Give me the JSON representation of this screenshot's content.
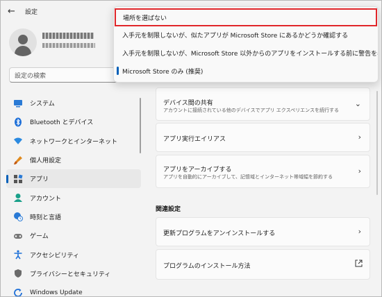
{
  "window": {
    "title": "設定"
  },
  "search": {
    "placeholder": "設定の検索"
  },
  "sidebar": {
    "items": [
      {
        "label": "システム",
        "icon": "monitor-icon"
      },
      {
        "label": "Bluetooth とデバイス",
        "icon": "bluetooth-icon"
      },
      {
        "label": "ネットワークとインターネット",
        "icon": "wifi-icon"
      },
      {
        "label": "個人用設定",
        "icon": "brush-icon"
      },
      {
        "label": "アプリ",
        "icon": "apps-icon"
      },
      {
        "label": "アカウント",
        "icon": "person-icon"
      },
      {
        "label": "時刻と言語",
        "icon": "globe-clock-icon"
      },
      {
        "label": "ゲーム",
        "icon": "gamepad-icon"
      },
      {
        "label": "アクセシビリティ",
        "icon": "accessibility-icon"
      },
      {
        "label": "プライバシーとセキュリティ",
        "icon": "shield-icon"
      },
      {
        "label": "Windows Update",
        "icon": "update-icon"
      }
    ]
  },
  "dropdown": {
    "options": [
      "場所を選ばない",
      "入手元を制限しないが、似たアプリが Microsoft Store にあるかどうか確認する",
      "入手元を制限しないが、Microsoft Store 以外からのアプリをインストールする前に警告を表示する",
      "Microsoft Store のみ (推奨)"
    ]
  },
  "main": {
    "share": {
      "title": "デバイス間の共有",
      "desc": "アカウントに接続されている他のデバイスでアプリ エクスペリエンスを続行する"
    },
    "alias": {
      "title": "アプリ実行エイリアス"
    },
    "archive": {
      "title": "アプリをアーカイブする",
      "desc": "アプリを自動的にアーカイブして、記憶域とインターネット帯域幅を節約する"
    },
    "related": {
      "heading": "関連設定",
      "uninstall": "更新プログラムをアンインストールする",
      "install": "プログラムのインストール方法"
    }
  },
  "colors": {
    "accent": "#005fb8",
    "highlight_border": "#e0262a"
  }
}
